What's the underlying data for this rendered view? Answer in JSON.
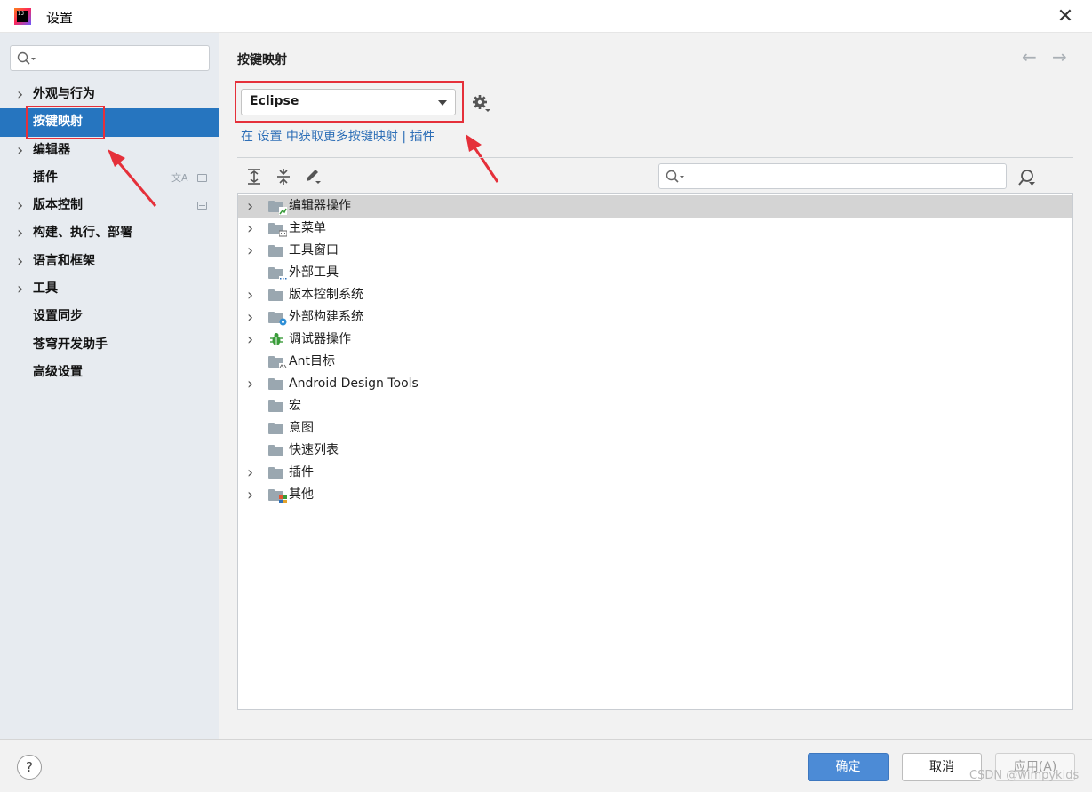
{
  "window": {
    "title": "设置",
    "close_glyph": "✕"
  },
  "sidebar": {
    "search": {
      "placeholder": "",
      "value": ""
    },
    "items": [
      {
        "label": "外观与行为",
        "expandable": true,
        "selected": false
      },
      {
        "label": "按键映射",
        "expandable": false,
        "selected": true
      },
      {
        "label": "编辑器",
        "expandable": true,
        "selected": false
      },
      {
        "label": "插件",
        "expandable": false,
        "selected": false,
        "badges": [
          "translate-icon",
          "settings-scope-icon"
        ]
      },
      {
        "label": "版本控制",
        "expandable": true,
        "selected": false,
        "badges": [
          "settings-scope-icon"
        ]
      },
      {
        "label": "构建、执行、部署",
        "expandable": true,
        "selected": false
      },
      {
        "label": "语言和框架",
        "expandable": true,
        "selected": false
      },
      {
        "label": "工具",
        "expandable": true,
        "selected": false
      },
      {
        "label": "设置同步",
        "expandable": false,
        "selected": false
      },
      {
        "label": "苍穹开发助手",
        "expandable": false,
        "selected": false
      },
      {
        "label": "高级设置",
        "expandable": false,
        "selected": false
      }
    ]
  },
  "main": {
    "title": "按键映射",
    "back_glyph": "←",
    "forward_glyph": "→",
    "keymap_select": {
      "value": "Eclipse"
    },
    "link": {
      "prefix": "在",
      "settings": "设置",
      "middle": "中获取更多按键映射",
      "separator": "|",
      "plugins": "插件"
    },
    "toolbar_icons": [
      "expand-all-icon",
      "collapse-all-icon",
      "edit-icon"
    ],
    "tree_search": {
      "placeholder": "",
      "value": ""
    },
    "tree": [
      {
        "label": "编辑器操作",
        "expandable": true,
        "selected": true,
        "overlay": "editor"
      },
      {
        "label": "主菜单",
        "expandable": true,
        "selected": false,
        "overlay": "menu"
      },
      {
        "label": "工具窗口",
        "expandable": true,
        "selected": false,
        "overlay": ""
      },
      {
        "label": "外部工具",
        "expandable": false,
        "selected": false,
        "overlay": "dots"
      },
      {
        "label": "版本控制系统",
        "expandable": true,
        "selected": false,
        "overlay": ""
      },
      {
        "label": "外部构建系统",
        "expandable": true,
        "selected": false,
        "overlay": "gear"
      },
      {
        "label": "调试器操作",
        "expandable": true,
        "selected": false,
        "overlay": "bug"
      },
      {
        "label": "Ant目标",
        "expandable": false,
        "selected": false,
        "overlay": "ant"
      },
      {
        "label": "Android Design Tools",
        "expandable": true,
        "selected": false,
        "overlay": ""
      },
      {
        "label": "宏",
        "expandable": false,
        "selected": false,
        "overlay": ""
      },
      {
        "label": "意图",
        "expandable": false,
        "selected": false,
        "overlay": ""
      },
      {
        "label": "快速列表",
        "expandable": false,
        "selected": false,
        "overlay": ""
      },
      {
        "label": "插件",
        "expandable": true,
        "selected": false,
        "overlay": ""
      },
      {
        "label": "其他",
        "expandable": true,
        "selected": false,
        "overlay": "color"
      }
    ]
  },
  "footer": {
    "help": "?",
    "ok": "确定",
    "cancel": "取消",
    "apply": "应用(A)"
  },
  "watermark": "CSDN @wimpykids",
  "colors": {
    "accent": "#2675bf",
    "ok_button": "#4c8bd6",
    "annotation": "#e5303a",
    "link": "#2e6fb7"
  }
}
